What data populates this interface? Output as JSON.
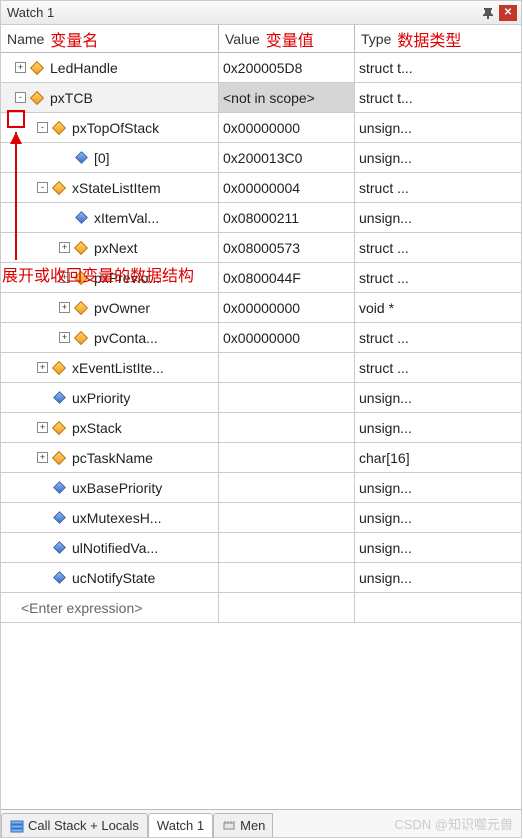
{
  "titlebar": {
    "title": "Watch 1"
  },
  "headers": {
    "name": "Name",
    "value": "Value",
    "type": "Type"
  },
  "annotations": {
    "name": "变量名",
    "value": "变量值",
    "type": "数据类型",
    "expand": "展开或收回变量的数据结构"
  },
  "rows": [
    {
      "depth": 0,
      "exp": "+",
      "iconKind": "struct",
      "name": "LedHandle",
      "value": "0x200005D8",
      "type": "struct t...",
      "selected": false
    },
    {
      "depth": 0,
      "exp": "-",
      "iconKind": "struct",
      "name": "pxTCB",
      "value": "<not in scope>",
      "type": "struct t...",
      "selected": true
    },
    {
      "depth": 1,
      "exp": "-",
      "iconKind": "struct",
      "name": "pxTopOfStack",
      "value": "0x00000000",
      "type": "unsign..."
    },
    {
      "depth": 2,
      "exp": "",
      "iconKind": "var",
      "name": "[0]",
      "value": "0x200013C0",
      "type": "unsign..."
    },
    {
      "depth": 1,
      "exp": "-",
      "iconKind": "struct",
      "name": "xStateListItem",
      "value": "0x00000004",
      "type": "struct ..."
    },
    {
      "depth": 2,
      "exp": "",
      "iconKind": "var",
      "name": "xItemVal...",
      "value": "0x08000211",
      "type": "unsign..."
    },
    {
      "depth": 2,
      "exp": "+",
      "iconKind": "struct",
      "name": "pxNext",
      "value": "0x08000573",
      "type": "struct ..."
    },
    {
      "depth": 2,
      "exp": "+",
      "iconKind": "struct",
      "name": "pxPrevio...",
      "value": "0x0800044F",
      "type": "struct ..."
    },
    {
      "depth": 2,
      "exp": "+",
      "iconKind": "struct",
      "name": "pvOwner",
      "value": "0x00000000",
      "type": "void *"
    },
    {
      "depth": 2,
      "exp": "+",
      "iconKind": "struct",
      "name": "pvConta...",
      "value": "0x00000000",
      "type": "struct ..."
    },
    {
      "depth": 1,
      "exp": "+",
      "iconKind": "struct",
      "name": "xEventListIte...",
      "value": "",
      "type": "struct ..."
    },
    {
      "depth": 1,
      "exp": "",
      "iconKind": "var",
      "name": "uxPriority",
      "value": "",
      "type": "unsign..."
    },
    {
      "depth": 1,
      "exp": "+",
      "iconKind": "struct",
      "name": "pxStack",
      "value": "",
      "type": "unsign..."
    },
    {
      "depth": 1,
      "exp": "+",
      "iconKind": "struct",
      "name": "pcTaskName",
      "value": "",
      "type": "char[16]"
    },
    {
      "depth": 1,
      "exp": "",
      "iconKind": "var",
      "name": "uxBasePriority",
      "value": "",
      "type": "unsign..."
    },
    {
      "depth": 1,
      "exp": "",
      "iconKind": "var",
      "name": "uxMutexesH...",
      "value": "",
      "type": "unsign..."
    },
    {
      "depth": 1,
      "exp": "",
      "iconKind": "var",
      "name": "ulNotifiedVa...",
      "value": "",
      "type": "unsign..."
    },
    {
      "depth": 1,
      "exp": "",
      "iconKind": "var",
      "name": "ucNotifyState",
      "value": "",
      "type": "unsign..."
    }
  ],
  "enter_expression": "<Enter expression>",
  "tabs": {
    "callstack": "Call Stack + Locals",
    "watch1": "Watch 1",
    "memory": "Men"
  },
  "watermark": "CSDN @知识噬元兽"
}
